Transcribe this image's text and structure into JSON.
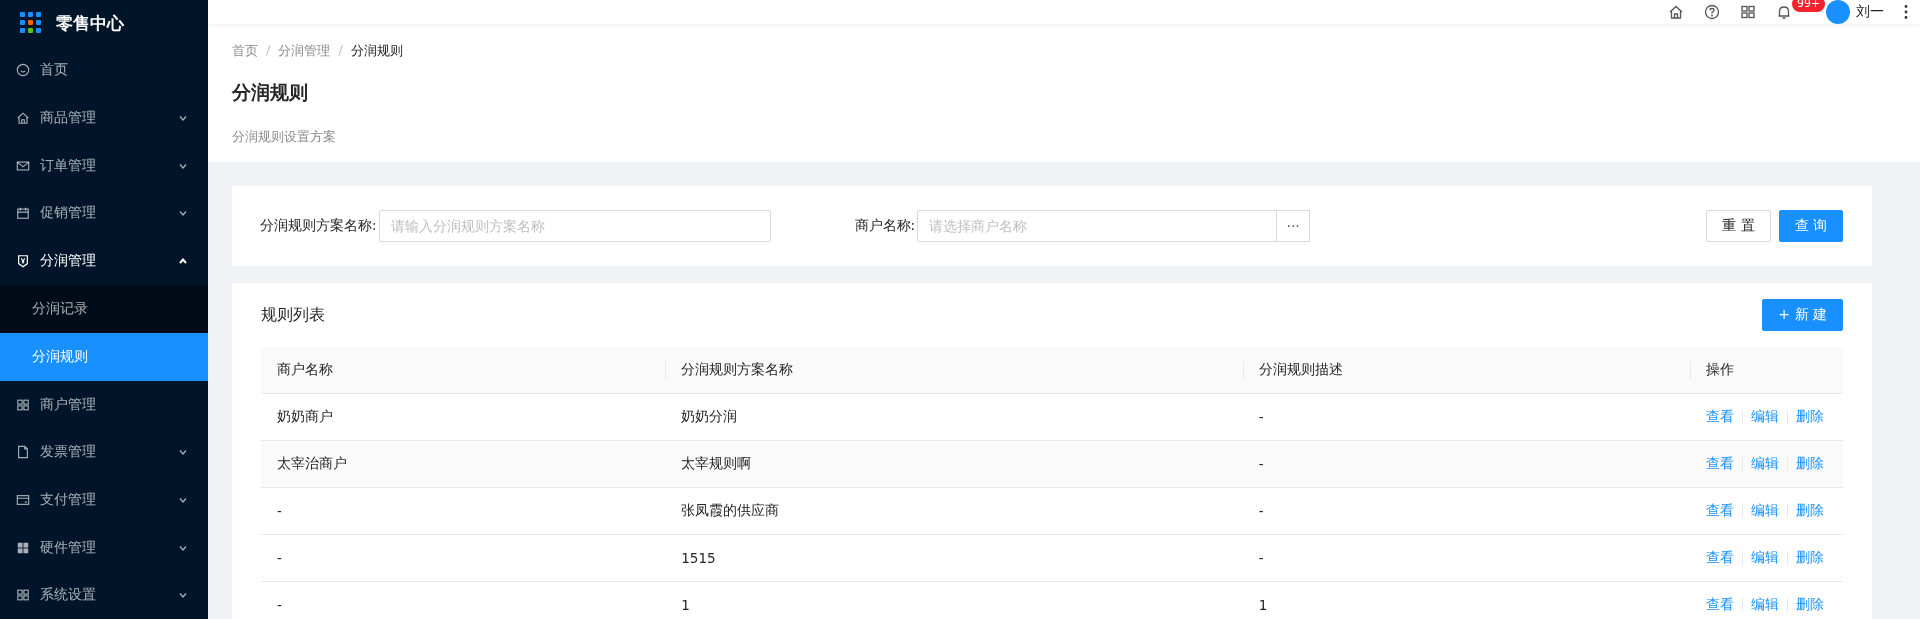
{
  "sidebar": {
    "logo": "零售中心",
    "items": [
      {
        "label": "首页",
        "kind": "link"
      },
      {
        "label": "商品管理",
        "kind": "group",
        "expanded": false
      },
      {
        "label": "订单管理",
        "kind": "group",
        "expanded": false
      },
      {
        "label": "促销管理",
        "kind": "group",
        "expanded": false
      },
      {
        "label": "分润管理",
        "kind": "group",
        "expanded": true,
        "children": [
          {
            "label": "分润记录",
            "selected": false
          },
          {
            "label": "分润规则",
            "selected": true
          }
        ]
      },
      {
        "label": "商户管理",
        "kind": "link"
      },
      {
        "label": "发票管理",
        "kind": "group",
        "expanded": false
      },
      {
        "label": "支付管理",
        "kind": "group",
        "expanded": false
      },
      {
        "label": "硬件管理",
        "kind": "group",
        "expanded": false
      },
      {
        "label": "系统设置",
        "kind": "group",
        "expanded": false
      }
    ]
  },
  "header": {
    "badge": "99+",
    "user": "刘一"
  },
  "breadcrumb": [
    "首页",
    "/",
    "分润管理",
    "/",
    "分润规则"
  ],
  "page": {
    "title": "分润规则",
    "subtitle": "分润规则设置方案"
  },
  "filters": {
    "fields": [
      {
        "label": "分润规则方案名称:",
        "placeholder": "请输入分润规则方案名称",
        "kind": "text"
      },
      {
        "label": "商户名称:",
        "placeholder": "请选择商户名称",
        "kind": "picker"
      }
    ],
    "picker_button": "···",
    "reset": "重 置",
    "search": "查 询"
  },
  "list": {
    "title": "规则列表",
    "new_button": "+ 新 建",
    "columns": [
      "商户名称",
      "分润规则方案名称",
      "分润规则描述",
      "操作"
    ],
    "rows": [
      {
        "cells": [
          "奶奶商户",
          "奶奶分润",
          "-"
        ],
        "actions": [
          "查看",
          "编辑",
          "删除"
        ]
      },
      {
        "cells": [
          "太宰治商户",
          "太宰规则啊",
          "-"
        ],
        "actions": [
          "查看",
          "编辑",
          "删除"
        ]
      },
      {
        "cells": [
          "-",
          "张凤霞的供应商",
          "-"
        ],
        "actions": [
          "查看",
          "编辑",
          "删除"
        ]
      },
      {
        "cells": [
          "-",
          "1515",
          "-"
        ],
        "actions": [
          "查看",
          "编辑",
          "删除"
        ]
      },
      {
        "cells": [
          "-",
          "1",
          "1"
        ],
        "actions": [
          "查看",
          "编辑",
          "删除"
        ]
      }
    ]
  }
}
